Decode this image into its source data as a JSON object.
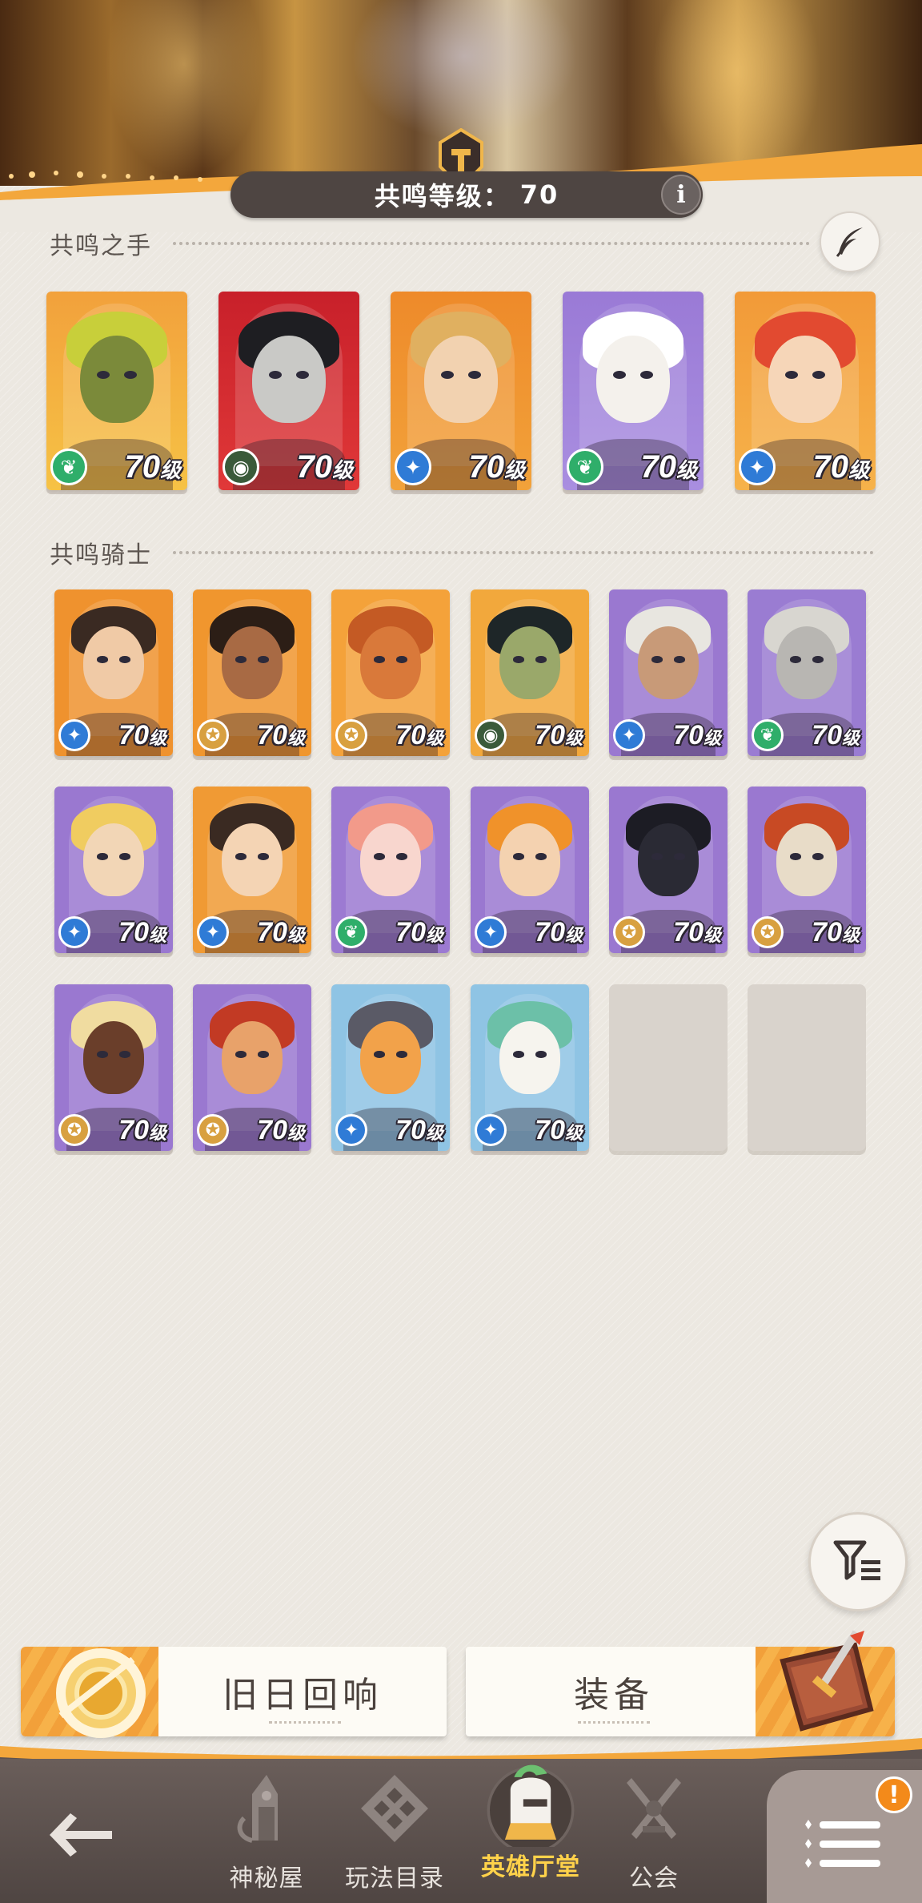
{
  "header": {
    "level_label": "共鸣等级：",
    "level_value": "70",
    "info_icon": "i"
  },
  "resonance_hands": {
    "title": "共鸣之手",
    "heroes": [
      {
        "level": "70",
        "unit": "级",
        "class_icon": "nature-icon",
        "bg": "#f2a13c",
        "frame": "#f6c245",
        "skin": "#7b8a3a",
        "hair": "#c8cf3a"
      },
      {
        "level": "70",
        "unit": "级",
        "class_icon": "eye-icon",
        "bg": "#c8202a",
        "frame": "#e03838",
        "skin": "#c9c9c6",
        "hair": "#1e1e22"
      },
      {
        "level": "70",
        "unit": "级",
        "class_icon": "star-icon",
        "bg": "#ee8a2a",
        "frame": "#f2a23a",
        "skin": "#f2d2b0",
        "hair": "#e0b060"
      },
      {
        "level": "70",
        "unit": "级",
        "class_icon": "nature-icon",
        "bg": "#9a7ad6",
        "frame": "#a98ee0",
        "skin": "#f4f1ec",
        "hair": "#ffffff"
      },
      {
        "level": "70",
        "unit": "级",
        "class_icon": "star-icon",
        "bg": "#f29a38",
        "frame": "#f6b24a",
        "skin": "#f6d6b8",
        "hair": "#e24a30"
      }
    ]
  },
  "resonance_knights": {
    "title": "共鸣骑士",
    "heroes": [
      {
        "level": "70",
        "unit": "级",
        "class_icon": "star-icon",
        "bg": "#ef922e",
        "skin": "#f0caa6",
        "hair": "#3a2a22"
      },
      {
        "level": "70",
        "unit": "级",
        "class_icon": "shield-icon",
        "bg": "#f0962e",
        "skin": "#a86a44",
        "hair": "#2c1e16"
      },
      {
        "level": "70",
        "unit": "级",
        "class_icon": "shield-icon",
        "bg": "#f4a23a",
        "skin": "#d9793a",
        "hair": "#c45a24"
      },
      {
        "level": "70",
        "unit": "级",
        "class_icon": "eye-icon",
        "bg": "#f2a83c",
        "skin": "#9aa86a",
        "hair": "#1e2628"
      },
      {
        "level": "70",
        "unit": "级",
        "class_icon": "star-icon",
        "bg": "#9a78d0",
        "skin": "#c89a78",
        "hair": "#e8e6e0"
      },
      {
        "level": "70",
        "unit": "级",
        "class_icon": "nature-icon",
        "bg": "#9a7cd2",
        "skin": "#b8b6b2",
        "hair": "#d8d6d0"
      },
      {
        "level": "70",
        "unit": "级",
        "class_icon": "star-icon",
        "bg": "#9a78d0",
        "skin": "#f2d6b6",
        "hair": "#f0cc60"
      },
      {
        "level": "70",
        "unit": "级",
        "class_icon": "star-icon",
        "bg": "#f09a34",
        "skin": "#f4d4b4",
        "hair": "#3a2a22"
      },
      {
        "level": "70",
        "unit": "级",
        "class_icon": "nature-icon",
        "bg": "#9c7ad2",
        "skin": "#f8d6ce",
        "hair": "#f29a8a"
      },
      {
        "level": "70",
        "unit": "级",
        "class_icon": "star-icon",
        "bg": "#9a78d0",
        "skin": "#f4d2b0",
        "hair": "#f0922a"
      },
      {
        "level": "70",
        "unit": "级",
        "class_icon": "shield-icon",
        "bg": "#9a78d0",
        "skin": "#2a2a34",
        "hair": "#1c1c24"
      },
      {
        "level": "70",
        "unit": "级",
        "class_icon": "shield-icon",
        "bg": "#9a78d0",
        "skin": "#e8dcc8",
        "hair": "#c84a24"
      },
      {
        "level": "70",
        "unit": "级",
        "class_icon": "shield-icon",
        "bg": "#9a78d0",
        "skin": "#6a3e2a",
        "hair": "#f0dca0"
      },
      {
        "level": "70",
        "unit": "级",
        "class_icon": "shield-icon",
        "bg": "#9a78d0",
        "skin": "#e8a26a",
        "hair": "#c23a24"
      },
      {
        "level": "70",
        "unit": "级",
        "class_icon": "star-icon",
        "bg": "#8fc4e4",
        "skin": "#f2a24a",
        "hair": "#5a5a66"
      },
      {
        "level": "70",
        "unit": "级",
        "class_icon": "star-icon",
        "bg": "#8fc4e4",
        "skin": "#f6f4ee",
        "hair": "#6cc0a8"
      }
    ],
    "empty_slots": 2
  },
  "buttons": {
    "echoes": "旧日回响",
    "equipment": "装备"
  },
  "nav": {
    "mystery_house": "神秘屋",
    "game_catalog": "玩法目录",
    "hero_hall": "英雄厅堂",
    "guild": "公会",
    "alert": "!"
  },
  "colors": {
    "accent": "#ffd24a",
    "panel": "#ece8e1",
    "nav_bg": "#5a4f4b",
    "orange": "#f2a03a"
  }
}
